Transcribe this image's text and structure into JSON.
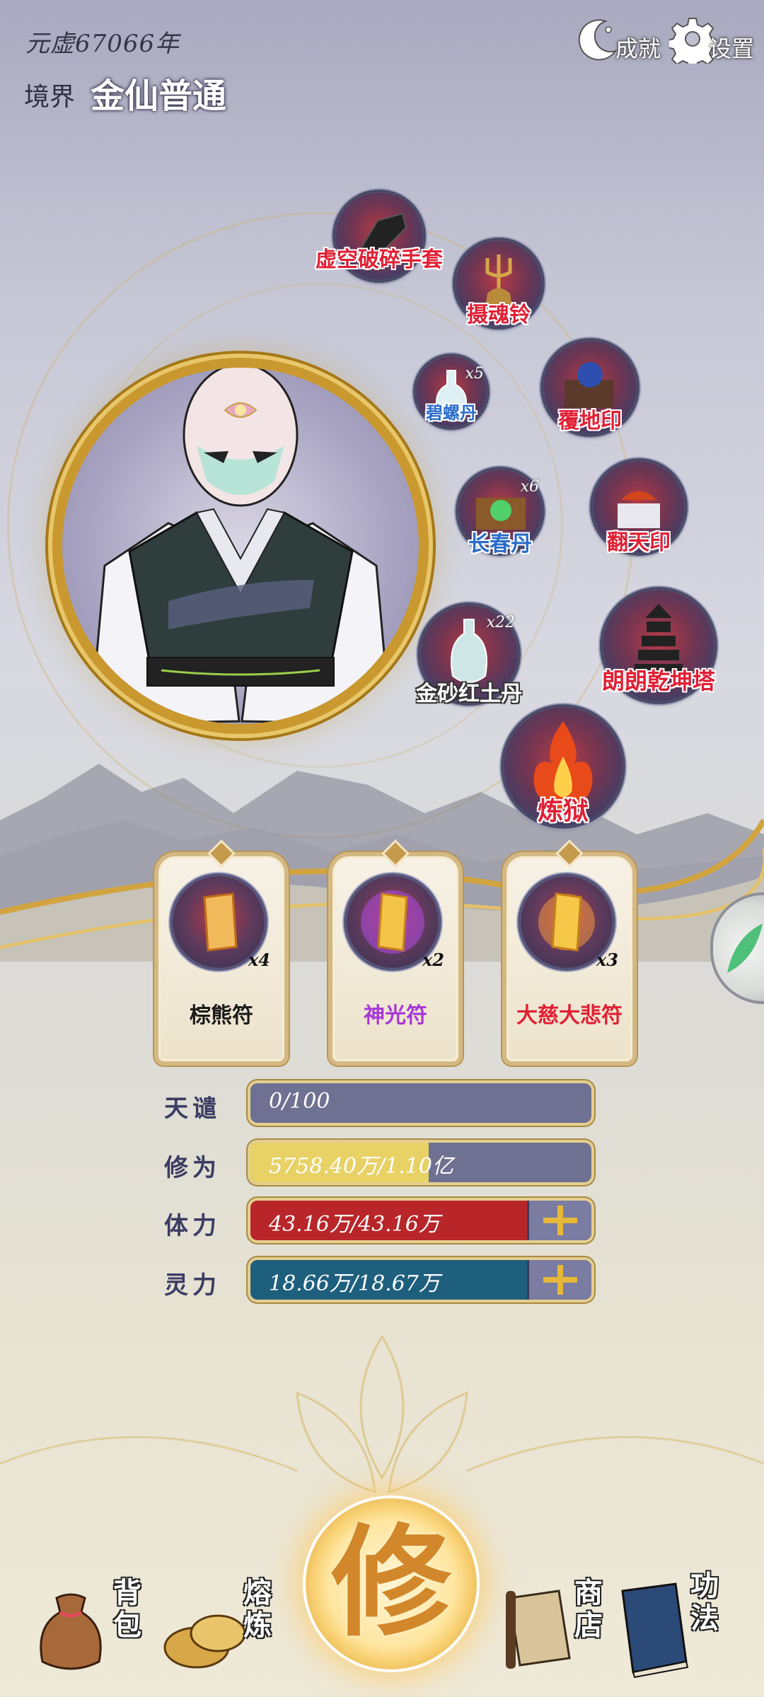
{
  "header": {
    "era": "元虚67066年",
    "realm_label": "境界",
    "realm_value": "金仙普通",
    "achievements_label": "成就",
    "settings_label": "设置"
  },
  "items": [
    {
      "name": "虚空破碎手套",
      "count": ""
    },
    {
      "name": "摄魂铃",
      "count": ""
    },
    {
      "name": "碧螺丹",
      "count": "x5"
    },
    {
      "name": "覆地印",
      "count": ""
    },
    {
      "name": "长春丹",
      "count": "x6"
    },
    {
      "name": "翻天印",
      "count": ""
    },
    {
      "name": "金砂红土丹",
      "count": "x22"
    },
    {
      "name": "朗朗乾坤塔",
      "count": ""
    },
    {
      "name": "炼狱",
      "count": ""
    }
  ],
  "talismans": [
    {
      "name": "棕熊符",
      "count": "x4",
      "color": "#1a1a1a"
    },
    {
      "name": "神光符",
      "count": "x2",
      "color": "#a836d8"
    },
    {
      "name": "大慈大悲符",
      "count": "x3",
      "color": "#e02035"
    }
  ],
  "stats": [
    {
      "label": "天谴",
      "text": "0/100",
      "fill": 0.0,
      "color": "#6f7193",
      "plus": false
    },
    {
      "label": "修为",
      "text": "5758.40万/1.10亿",
      "fill": 0.523,
      "color": "#e8d266",
      "plus": false
    },
    {
      "label": "体力",
      "text": "43.16万/43.16万",
      "fill": 1.0,
      "color": "#b8262a",
      "plus": true
    },
    {
      "label": "灵力",
      "text": "18.66万/18.67万",
      "fill": 0.999,
      "color": "#1f5f7e",
      "plus": true
    }
  ],
  "nav": {
    "bag": "背包",
    "smelt": "熔炼",
    "cultivate": "修",
    "shop": "商店",
    "skills": "功法"
  }
}
